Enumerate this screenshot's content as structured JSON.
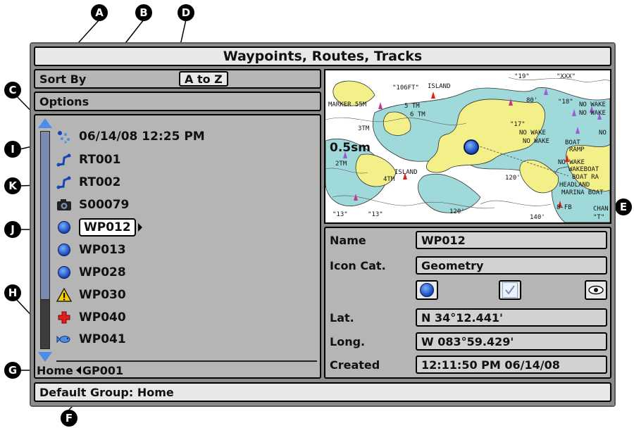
{
  "callouts": [
    "A",
    "B",
    "C",
    "D",
    "E",
    "F",
    "G",
    "H",
    "I",
    "J",
    "K"
  ],
  "title": "Waypoints, Routes, Tracks",
  "sort_by": {
    "label": "Sort By",
    "value": "A to Z"
  },
  "options_label": "Options",
  "list": {
    "items": [
      {
        "icon": "track-icon",
        "text": "06/14/08 12:25 PM"
      },
      {
        "icon": "route-icon",
        "text": "RT001"
      },
      {
        "icon": "route-icon",
        "text": "RT002"
      },
      {
        "icon": "snapshot-camera-icon",
        "text": "S00079"
      },
      {
        "icon": "waypoint-geometry-icon",
        "text": "WP012",
        "selected": true
      },
      {
        "icon": "waypoint-geometry-icon",
        "text": "WP013"
      },
      {
        "icon": "waypoint-geometry-icon",
        "text": "WP028"
      },
      {
        "icon": "warning-icon",
        "text": "WP030"
      },
      {
        "icon": "first-aid-cross-icon",
        "text": "WP040"
      },
      {
        "icon": "fish-icon",
        "text": "WP041"
      }
    ]
  },
  "breadcrumb": {
    "group": "Home",
    "current": "GP001"
  },
  "map": {
    "scale": "0.5sm",
    "labels": [
      "MARKER 55M",
      "3TM",
      "6 TM",
      "5 TM",
      "ISLAND",
      "\"13\"",
      "\"19\"",
      "\"XXX\"",
      "\"106FT\"",
      "80'",
      "\"18\"",
      "\"17\"",
      "NO WAKE",
      "NO WAKE",
      "NO WAKE",
      "NO WAKE",
      "BOAT",
      "RAMP",
      "NO WAKE",
      "WAKEBOAT",
      "BOAT RA",
      "HEADLAND",
      "MARINA BOAT",
      "ISLAND",
      "4TM",
      "2TM",
      "120'",
      "120'",
      "\"13\"",
      "8-FB",
      "140'",
      "CHAN",
      "\"T\"",
      "NO"
    ]
  },
  "details": {
    "name_label": "Name",
    "name_value": "WP012",
    "icon_label": "Icon Cat.",
    "icon_value": "Geometry",
    "lat_label": "Lat.",
    "lat_value": "N 34°12.441'",
    "long_label": "Long.",
    "long_value": "W 083°59.429'",
    "created_label": "Created",
    "created_value": "12:11:50 PM 06/14/08"
  },
  "status": "Default Group: Home",
  "colors": {
    "land": "#f3f08a",
    "shallow": "#9fd9d9",
    "water": "#ffffff",
    "waypoint": "#1446b8",
    "scrollbar": "#7b8bb0"
  }
}
